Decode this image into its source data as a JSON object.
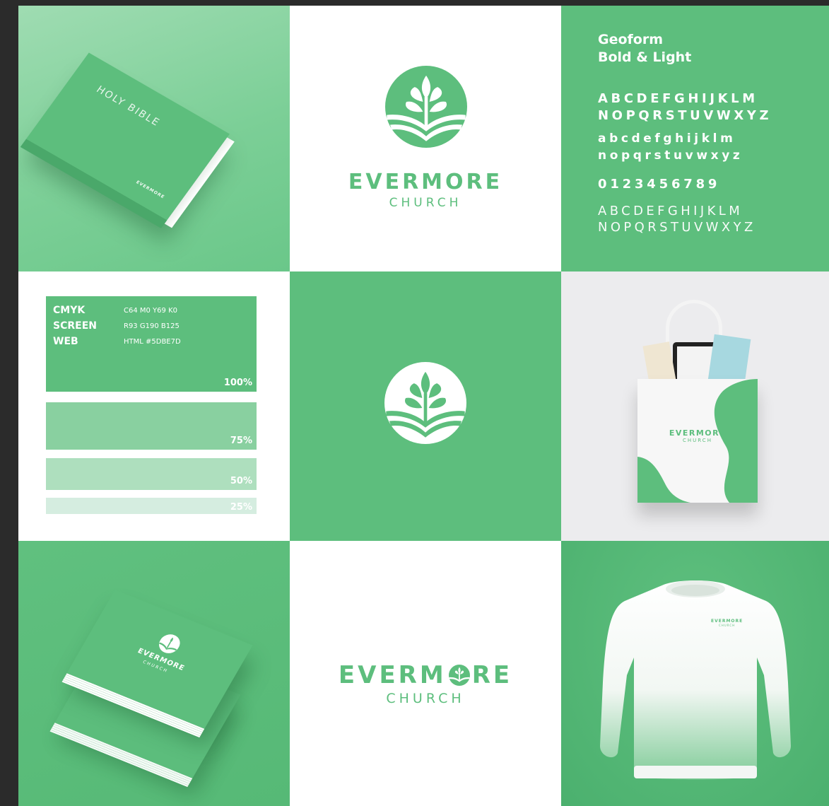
{
  "brand": {
    "name": "EVERMORE",
    "name_prefix": "EVERM",
    "name_suffix": "RE",
    "tagline": "CHURCH",
    "color": "#5DBE7D"
  },
  "bible": {
    "title": "HOLY BIBLE",
    "brand_text": "EVERMORE"
  },
  "typography": {
    "font_name": "Geoform",
    "weights": "Bold & Light",
    "bold_upper_1": "ABCDEFGHIJKLM",
    "bold_upper_2": "NOPQRSTUVWXYZ",
    "bold_lower_1": "abcdefghijklm",
    "bold_lower_2": "nopqrstuvwxyz",
    "numbers": "0123456789",
    "light_upper_1": "ABCDEFGHIJKLM",
    "light_upper_2": "NOPQRSTUVWXYZ"
  },
  "palette": {
    "specs": [
      {
        "label": "CMYK",
        "value": "C64 M0 Y69 K0"
      },
      {
        "label": "SCREEN",
        "value": "R93 G190 B125"
      },
      {
        "label": "WEB",
        "value": "HTML #5DBE7D"
      }
    ],
    "tints": [
      {
        "percent": "100%",
        "color": "#5dbe7d"
      },
      {
        "percent": "75%",
        "color": "#89d0a0"
      },
      {
        "percent": "50%",
        "color": "#aedfbe"
      },
      {
        "percent": "25%",
        "color": "#d5ede0"
      }
    ]
  }
}
